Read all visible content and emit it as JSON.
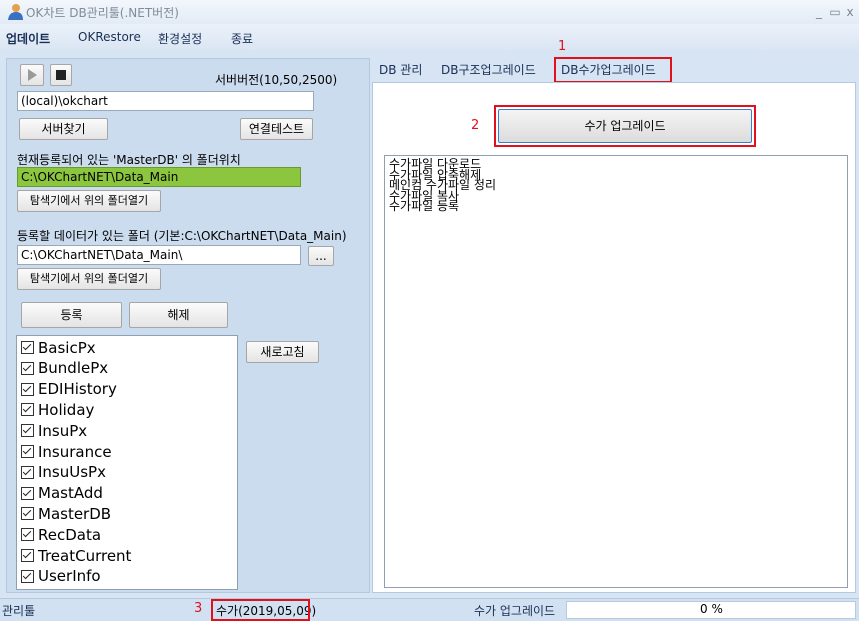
{
  "window": {
    "title": "OK차트 DB관리툴(.NET버전)",
    "controls": [
      "_",
      "▭",
      "x"
    ]
  },
  "menu": [
    "업데이트",
    "OKRestore",
    "환경설정",
    "종료"
  ],
  "left": {
    "server_version": "서버버전(10,50,2500)",
    "server_value": "(local)\\okchart",
    "find_server": "서버찾기",
    "test_conn": "연결테스트",
    "registered_label": "현재등록되어 있는 'MasterDB' 의 폴더위치",
    "registered_path": "C:\\OKChartNET\\Data_Main",
    "open_explorer_1": "탐색기에서 위의 폴더열기",
    "data_folder_label": "등록할 데이터가 있는 폴더 (기본:C:\\OKChartNET\\Data_Main)",
    "data_folder_value": "C:\\OKChartNET\\Data_Main\\",
    "browse": "...",
    "open_explorer_2": "탐색기에서 위의 폴더열기",
    "register": "등록",
    "unregister": "해제",
    "refresh": "새로고침",
    "items": [
      "BasicPx",
      "BundlePx",
      "EDIHistory",
      "Holiday",
      "InsuPx",
      "Insurance",
      "InsuUsPx",
      "MastAdd",
      "MasterDB",
      "RecData",
      "TreatCurrent",
      "UserInfo"
    ]
  },
  "tabs": [
    "DB 관리",
    "DB구조업그레이드",
    "DB수가업그레이드"
  ],
  "right": {
    "upgrade_button": "수가 업그레이드",
    "log": [
      "수가파일 다운로드",
      "수가파일 압축해제",
      "메인컴 수가파일 정리",
      "수가파일 복사",
      "수가파일 등록"
    ]
  },
  "annotations": [
    "1",
    "2",
    "3"
  ],
  "status": {
    "tool": "관리툴",
    "fee": "수가(2019,05,09)",
    "task": "수가 업그레이드",
    "progress": "0 %"
  },
  "colors": {
    "accent_red": "#e1111b",
    "path_highlight": "#8cc63f"
  }
}
